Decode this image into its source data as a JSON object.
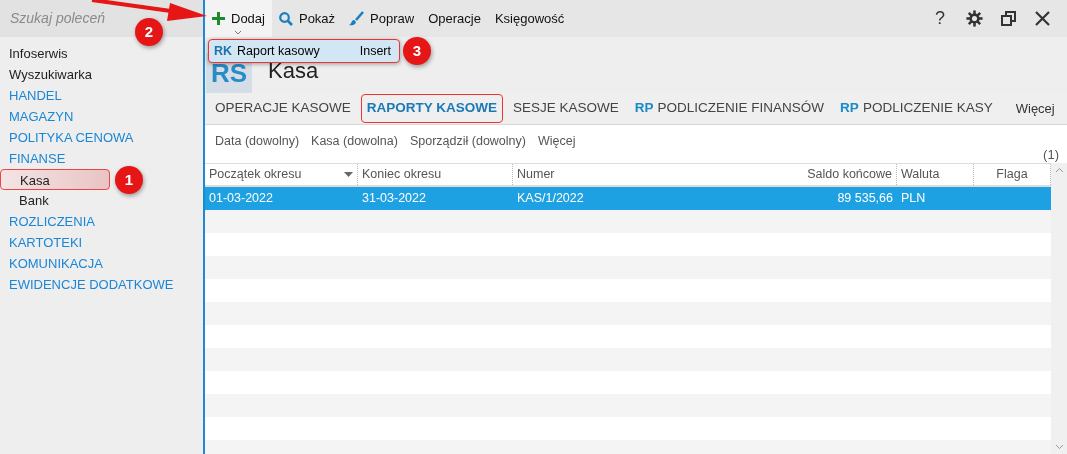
{
  "search": {
    "placeholder": "Szukaj poleceń"
  },
  "sidebar": {
    "items": [
      {
        "label": "Infoserwis",
        "kind": "plain"
      },
      {
        "label": "Wyszukiwarka",
        "kind": "plain"
      },
      {
        "label": "HANDEL",
        "kind": "section"
      },
      {
        "label": "MAGAZYN",
        "kind": "section"
      },
      {
        "label": "POLITYKA CENOWA",
        "kind": "section"
      },
      {
        "label": "FINANSE",
        "kind": "section",
        "children": [
          {
            "label": "Kasa",
            "callout": "1"
          },
          {
            "label": "Bank"
          }
        ]
      },
      {
        "label": "ROZLICZENIA",
        "kind": "section"
      },
      {
        "label": "KARTOTEKI",
        "kind": "section"
      },
      {
        "label": "KOMUNIKACJA",
        "kind": "section"
      },
      {
        "label": "EWIDENCJE DODATKOWE",
        "kind": "section"
      }
    ]
  },
  "toolbar": [
    {
      "label": "Dodaj",
      "kind": "add",
      "open": true,
      "callout": "2"
    },
    {
      "label": "Pokaż",
      "kind": "view"
    },
    {
      "label": "Popraw",
      "kind": "edit"
    },
    {
      "label": "Operacje",
      "kind": "text"
    },
    {
      "label": "Księgowość",
      "kind": "text"
    }
  ],
  "window_controls": {
    "help": "?"
  },
  "menu": {
    "prefix": "RK",
    "label": "Raport kasowy",
    "shortcut": "Insert",
    "callout": "3"
  },
  "header": {
    "badge": "RS",
    "title": "Kasa"
  },
  "tabs": [
    {
      "label": "OPERACJE KASOWE",
      "selected": false
    },
    {
      "label": "RAPORTY KASOWE",
      "selected": true,
      "outlined": true
    },
    {
      "label": "SESJE KASOWE",
      "selected": false
    },
    {
      "prefix": "RP",
      "label": "PODLICZENIE FINANSÓW",
      "selected": false
    },
    {
      "prefix": "RP",
      "label": "PODLICZENIE KASY",
      "selected": false
    }
  ],
  "tabs_more": "Więcej",
  "filters": [
    "Data (dowolny)",
    "Kasa (dowolna)",
    "Sporządził (dowolny)",
    "Więcej"
  ],
  "count": "(1)",
  "table": {
    "columns": [
      {
        "label": "Początek okresu",
        "sorted": true
      },
      {
        "label": "Koniec okresu"
      },
      {
        "label": "Numer"
      },
      {
        "label": "Saldo końcowe"
      },
      {
        "label": "Waluta"
      },
      {
        "label": "Flaga"
      }
    ],
    "rows": [
      {
        "cells": [
          "01-03-2022",
          "31-03-2022",
          "KAS/1/2022",
          "89 535,66",
          "PLN"
        ],
        "selected": true
      }
    ]
  }
}
